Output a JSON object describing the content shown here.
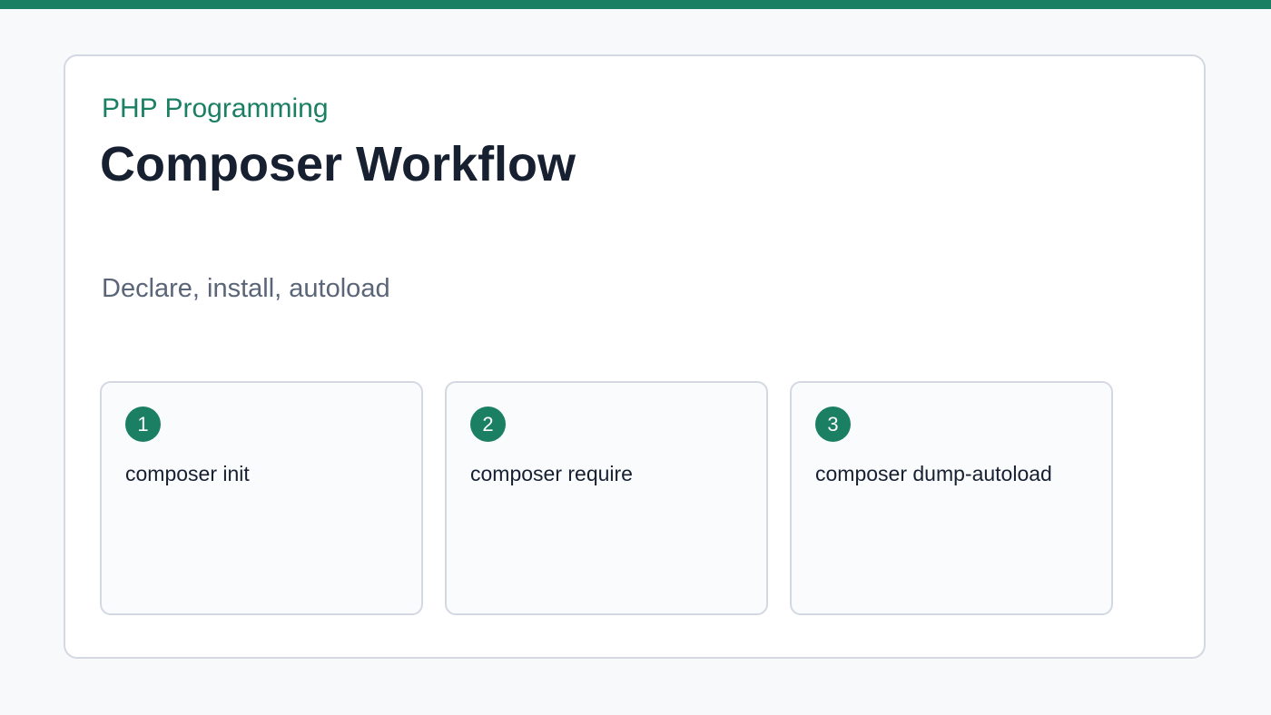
{
  "header": {
    "eyebrow": "PHP Programming",
    "title": "Composer Workflow",
    "subtitle": "Declare, install, autoload"
  },
  "steps": [
    {
      "number": "1",
      "label": "composer init"
    },
    {
      "number": "2",
      "label": "composer require"
    },
    {
      "number": "3",
      "label": "composer dump-autoload"
    }
  ],
  "colors": {
    "accent": "#1b7f63",
    "background": "#f7f9fb",
    "card": "#ffffff",
    "border": "#d3d8e2",
    "title_text": "#172030",
    "subtitle_text": "#5a6577"
  }
}
